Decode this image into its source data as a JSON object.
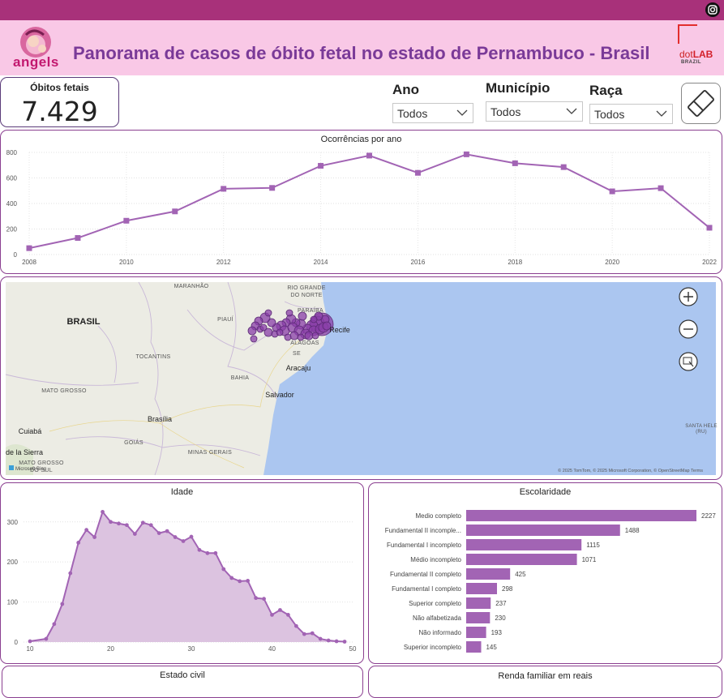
{
  "header": {
    "logo_text": "angels",
    "title": "Panorama de casos de óbito fetal no estado de Pernambuco - Brasil",
    "partner_logo_main": "dot",
    "partner_logo_bold": "LAB",
    "partner_logo_sub": "BRAZIL",
    "social_icon": "instagram-icon"
  },
  "kpi": {
    "label": "Óbitos fetais",
    "value": "7.429"
  },
  "filters": [
    {
      "title": "Ano",
      "value": "Todos"
    },
    {
      "title": "Município",
      "value": "Todos"
    },
    {
      "title": "Raça",
      "value": "Todos"
    }
  ],
  "clear_filters_icon": "eraser-icon",
  "colors": {
    "accent": "#a8317a",
    "header_bg": "#f9c8e6",
    "series": "#a264b4",
    "title": "#7a3a98"
  },
  "chart_data": [
    {
      "type": "line",
      "title": "Ocorrências por ano",
      "x": [
        2008,
        2009,
        2010,
        2011,
        2012,
        2013,
        2014,
        2015,
        2016,
        2017,
        2018,
        2019,
        2020,
        2021,
        2022
      ],
      "values": [
        50,
        130,
        265,
        338,
        515,
        522,
        695,
        775,
        640,
        785,
        715,
        685,
        495,
        520,
        210
      ],
      "xticks": [
        "2008",
        "2010",
        "2012",
        "2014",
        "2016",
        "2018",
        "2020",
        "2022"
      ],
      "yticks": [
        "0",
        "200",
        "400",
        "600",
        "800"
      ],
      "ylim": [
        0,
        800
      ],
      "grid": true
    },
    {
      "type": "area",
      "title": "Idade",
      "x": [
        10,
        12,
        13,
        14,
        15,
        16,
        17,
        18,
        19,
        20,
        21,
        22,
        23,
        24,
        25,
        26,
        27,
        28,
        29,
        30,
        31,
        32,
        33,
        34,
        35,
        36,
        37,
        38,
        39,
        40,
        41,
        42,
        43,
        44,
        45,
        46,
        47,
        48,
        49
      ],
      "values": [
        2,
        8,
        45,
        95,
        172,
        248,
        280,
        262,
        325,
        300,
        296,
        292,
        270,
        298,
        292,
        272,
        277,
        262,
        252,
        263,
        230,
        222,
        222,
        182,
        160,
        152,
        153,
        110,
        108,
        68,
        80,
        68,
        40,
        20,
        22,
        8,
        4,
        2,
        1
      ],
      "xticks": [
        "10",
        "20",
        "30",
        "40",
        "50"
      ],
      "yticks": [
        "0",
        "100",
        "200",
        "300"
      ],
      "xlim": [
        10,
        50
      ],
      "ylim": [
        0,
        340
      ],
      "grid": true
    },
    {
      "type": "bar",
      "title": "Escolaridade",
      "categories": [
        "Medio completo",
        "Fundamental II incomple...",
        "Fundamental I incompleto",
        "Médio incompleto",
        "Fundamental II completo",
        "Fundamental I completo",
        "Superior completo",
        "Não alfabetizada",
        "Não informado",
        "Superior incompleto"
      ],
      "values": [
        2227,
        1488,
        1115,
        1071,
        425,
        298,
        237,
        230,
        193,
        145
      ],
      "value_labels": [
        "2227",
        "1488",
        "1115",
        "1071",
        "425",
        "298",
        "237",
        "230",
        "193",
        "145"
      ],
      "xlim": [
        0,
        2227
      ]
    }
  ],
  "map": {
    "labels": [
      {
        "text": "MARANHÃO",
        "kind": "state"
      },
      {
        "text": "RIO GRANDE",
        "kind": "state"
      },
      {
        "text": "DO NORTE",
        "kind": "state"
      },
      {
        "text": "PIAUÍ",
        "kind": "state"
      },
      {
        "text": "PARAÍBA",
        "kind": "state"
      },
      {
        "text": "BRASIL",
        "kind": "country"
      },
      {
        "text": "Recife",
        "kind": "city"
      },
      {
        "text": "TOCANTINS",
        "kind": "state"
      },
      {
        "text": "ALAGOAS",
        "kind": "state"
      },
      {
        "text": "SE",
        "kind": "state"
      },
      {
        "text": "Aracaju",
        "kind": "city"
      },
      {
        "text": "BAHIA",
        "kind": "state"
      },
      {
        "text": "MATO GROSSO",
        "kind": "state"
      },
      {
        "text": "Salvador",
        "kind": "city"
      },
      {
        "text": "Brasília",
        "kind": "city"
      },
      {
        "text": "Cuiabá",
        "kind": "city"
      },
      {
        "text": "GOIÁS",
        "kind": "state"
      },
      {
        "text": "MINAS GERAIS",
        "kind": "state"
      },
      {
        "text": "de la Sierra",
        "kind": "city"
      },
      {
        "text": "MATO GROSSO",
        "kind": "state"
      },
      {
        "text": "DO SUL",
        "kind": "state"
      },
      {
        "text": "SANTA HELE",
        "kind": "state"
      },
      {
        "text": "(RU)",
        "kind": "state"
      }
    ],
    "attribution": "© 2025 TomTom, © 2025 Microsoft Corporation, © OpenStreetMap  Terms",
    "provider": "Microsoft Bing",
    "controls": [
      "zoom-in-icon",
      "zoom-out-icon",
      "select-icon"
    ]
  },
  "bottom_titles": {
    "civil": "Estado civil",
    "renda": "Renda familiar em reais"
  }
}
